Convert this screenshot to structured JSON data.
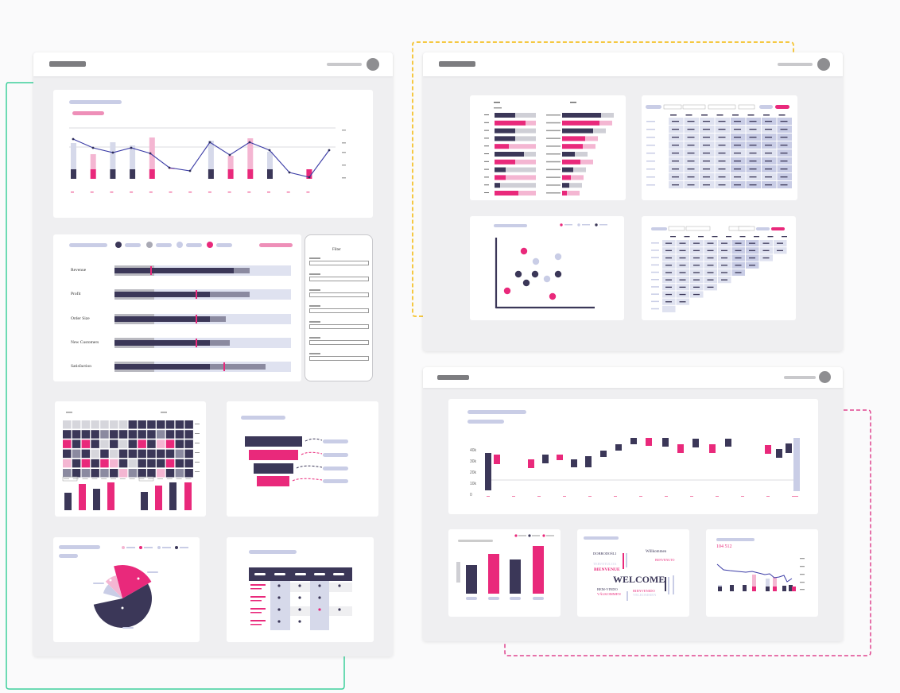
{
  "kpi": {
    "rows": [
      {
        "label": "Revenue"
      },
      {
        "label": "Profit"
      },
      {
        "label": "Order Size"
      },
      {
        "label": "New Customers"
      },
      {
        "label": "Satisfaction"
      }
    ],
    "filter_title": "Filter"
  },
  "waterfall": {
    "y_ticks": [
      "40k",
      "30k",
      "20k",
      "10k",
      "0"
    ]
  },
  "wordcloud": {
    "words": [
      "WELCOME",
      "BIENVENUE",
      "BIENVENIDO",
      "VÄLKOMMEN",
      "Willkommen",
      "BENVENUTO",
      "DOBRODOŠLI",
      "BEM-VINDO",
      "VELKOMMEN",
      "TERVETULOA"
    ]
  },
  "mini_line": {
    "value": "104 512"
  },
  "colors": {
    "navy": "#3b3758",
    "pink": "#e9297b",
    "light_pink": "#f4b6d2",
    "lavender": "#c9cde6",
    "teal_connector": "#3ccf9b",
    "yellow_connector": "#f5c842",
    "magenta_connector": "#e0458f"
  },
  "icons": [
    "avatar-icon"
  ]
}
